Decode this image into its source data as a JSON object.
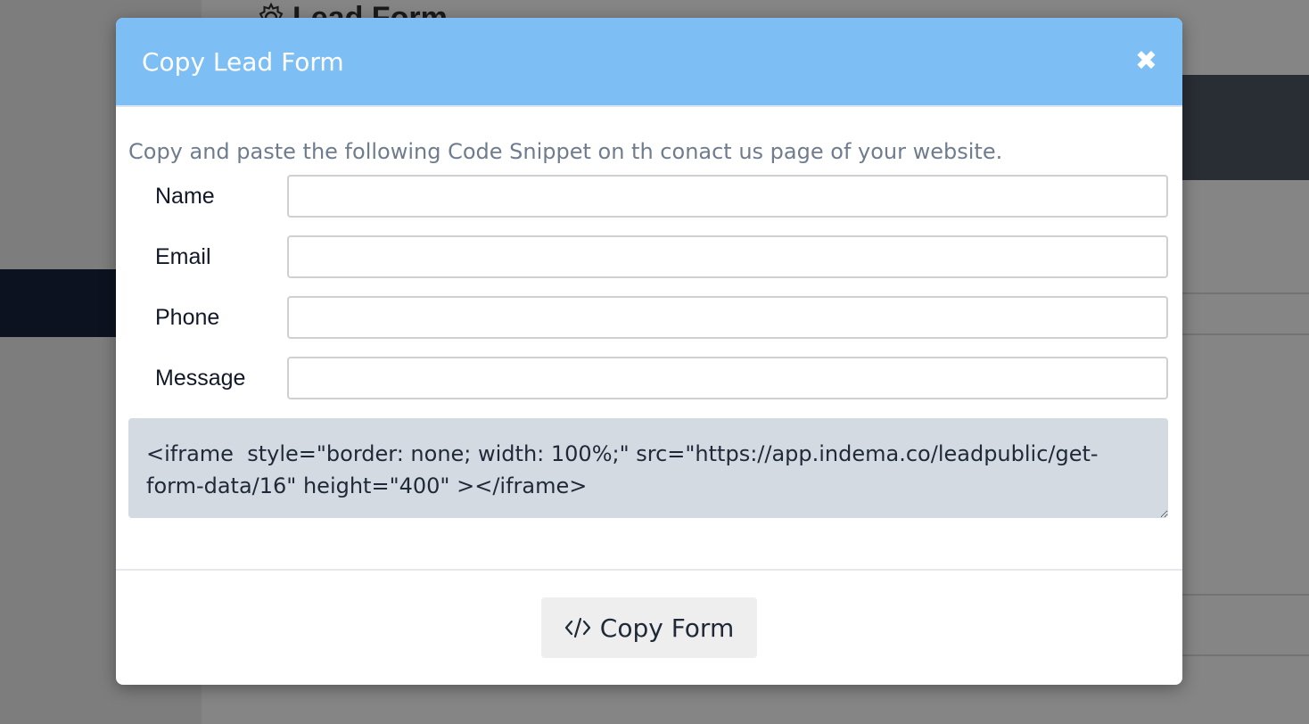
{
  "background": {
    "page_title": "Lead Form"
  },
  "modal": {
    "title": "Copy Lead Form",
    "close_icon": "close-icon",
    "instructions": "Copy and paste the following Code Snippet on th conact us page of your website.",
    "fields": [
      {
        "label": "Name",
        "value": ""
      },
      {
        "label": "Email",
        "value": ""
      },
      {
        "label": "Phone",
        "value": ""
      },
      {
        "label": "Message",
        "value": ""
      }
    ],
    "code_snippet": "<iframe  style=\"border: none; width: 100%;\" src=\"https://app.indema.co/leadpublic/get-form-data/16\" height=\"400\" ></iframe>",
    "copy_button": {
      "icon": "code-icon",
      "label": "Copy Form"
    }
  },
  "colors": {
    "header_bg": "#7dbff5",
    "code_bg": "#d4dae2",
    "instructions_text": "#6f7c8e"
  }
}
